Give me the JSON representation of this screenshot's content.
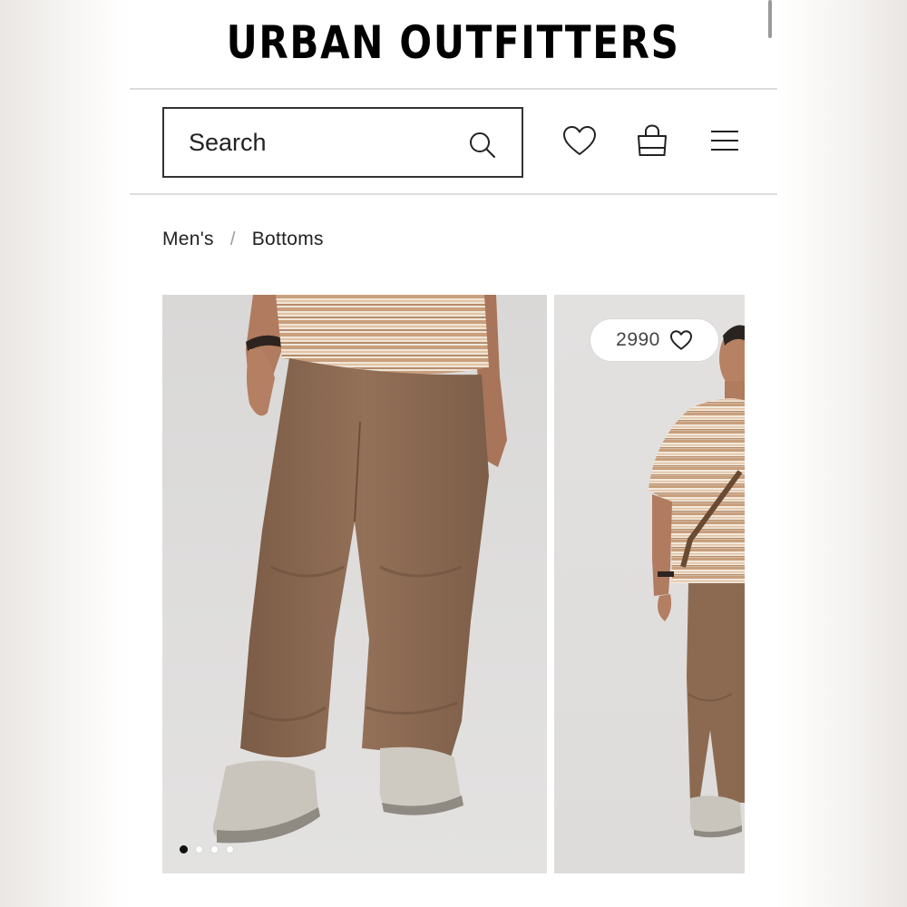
{
  "brand": {
    "logo_text": "URBAN OUTFITTERS"
  },
  "toolbar": {
    "search": {
      "placeholder": "Search",
      "value": ""
    },
    "icons": [
      "search-icon",
      "heart-icon",
      "shopping-bag-icon",
      "hamburger-menu-icon"
    ]
  },
  "breadcrumb": {
    "items": [
      {
        "label": "Men's"
      },
      {
        "label": "Bottoms"
      }
    ],
    "separator": "/"
  },
  "product": {
    "favorites_count": "2990",
    "image_carousel": {
      "total_images": 4,
      "active_index": 0
    }
  },
  "colors": {
    "pants": "#8c6a52",
    "background_photo": "#dcdad8",
    "text": "#1b1b1b",
    "divider": "#dcdcdc"
  }
}
